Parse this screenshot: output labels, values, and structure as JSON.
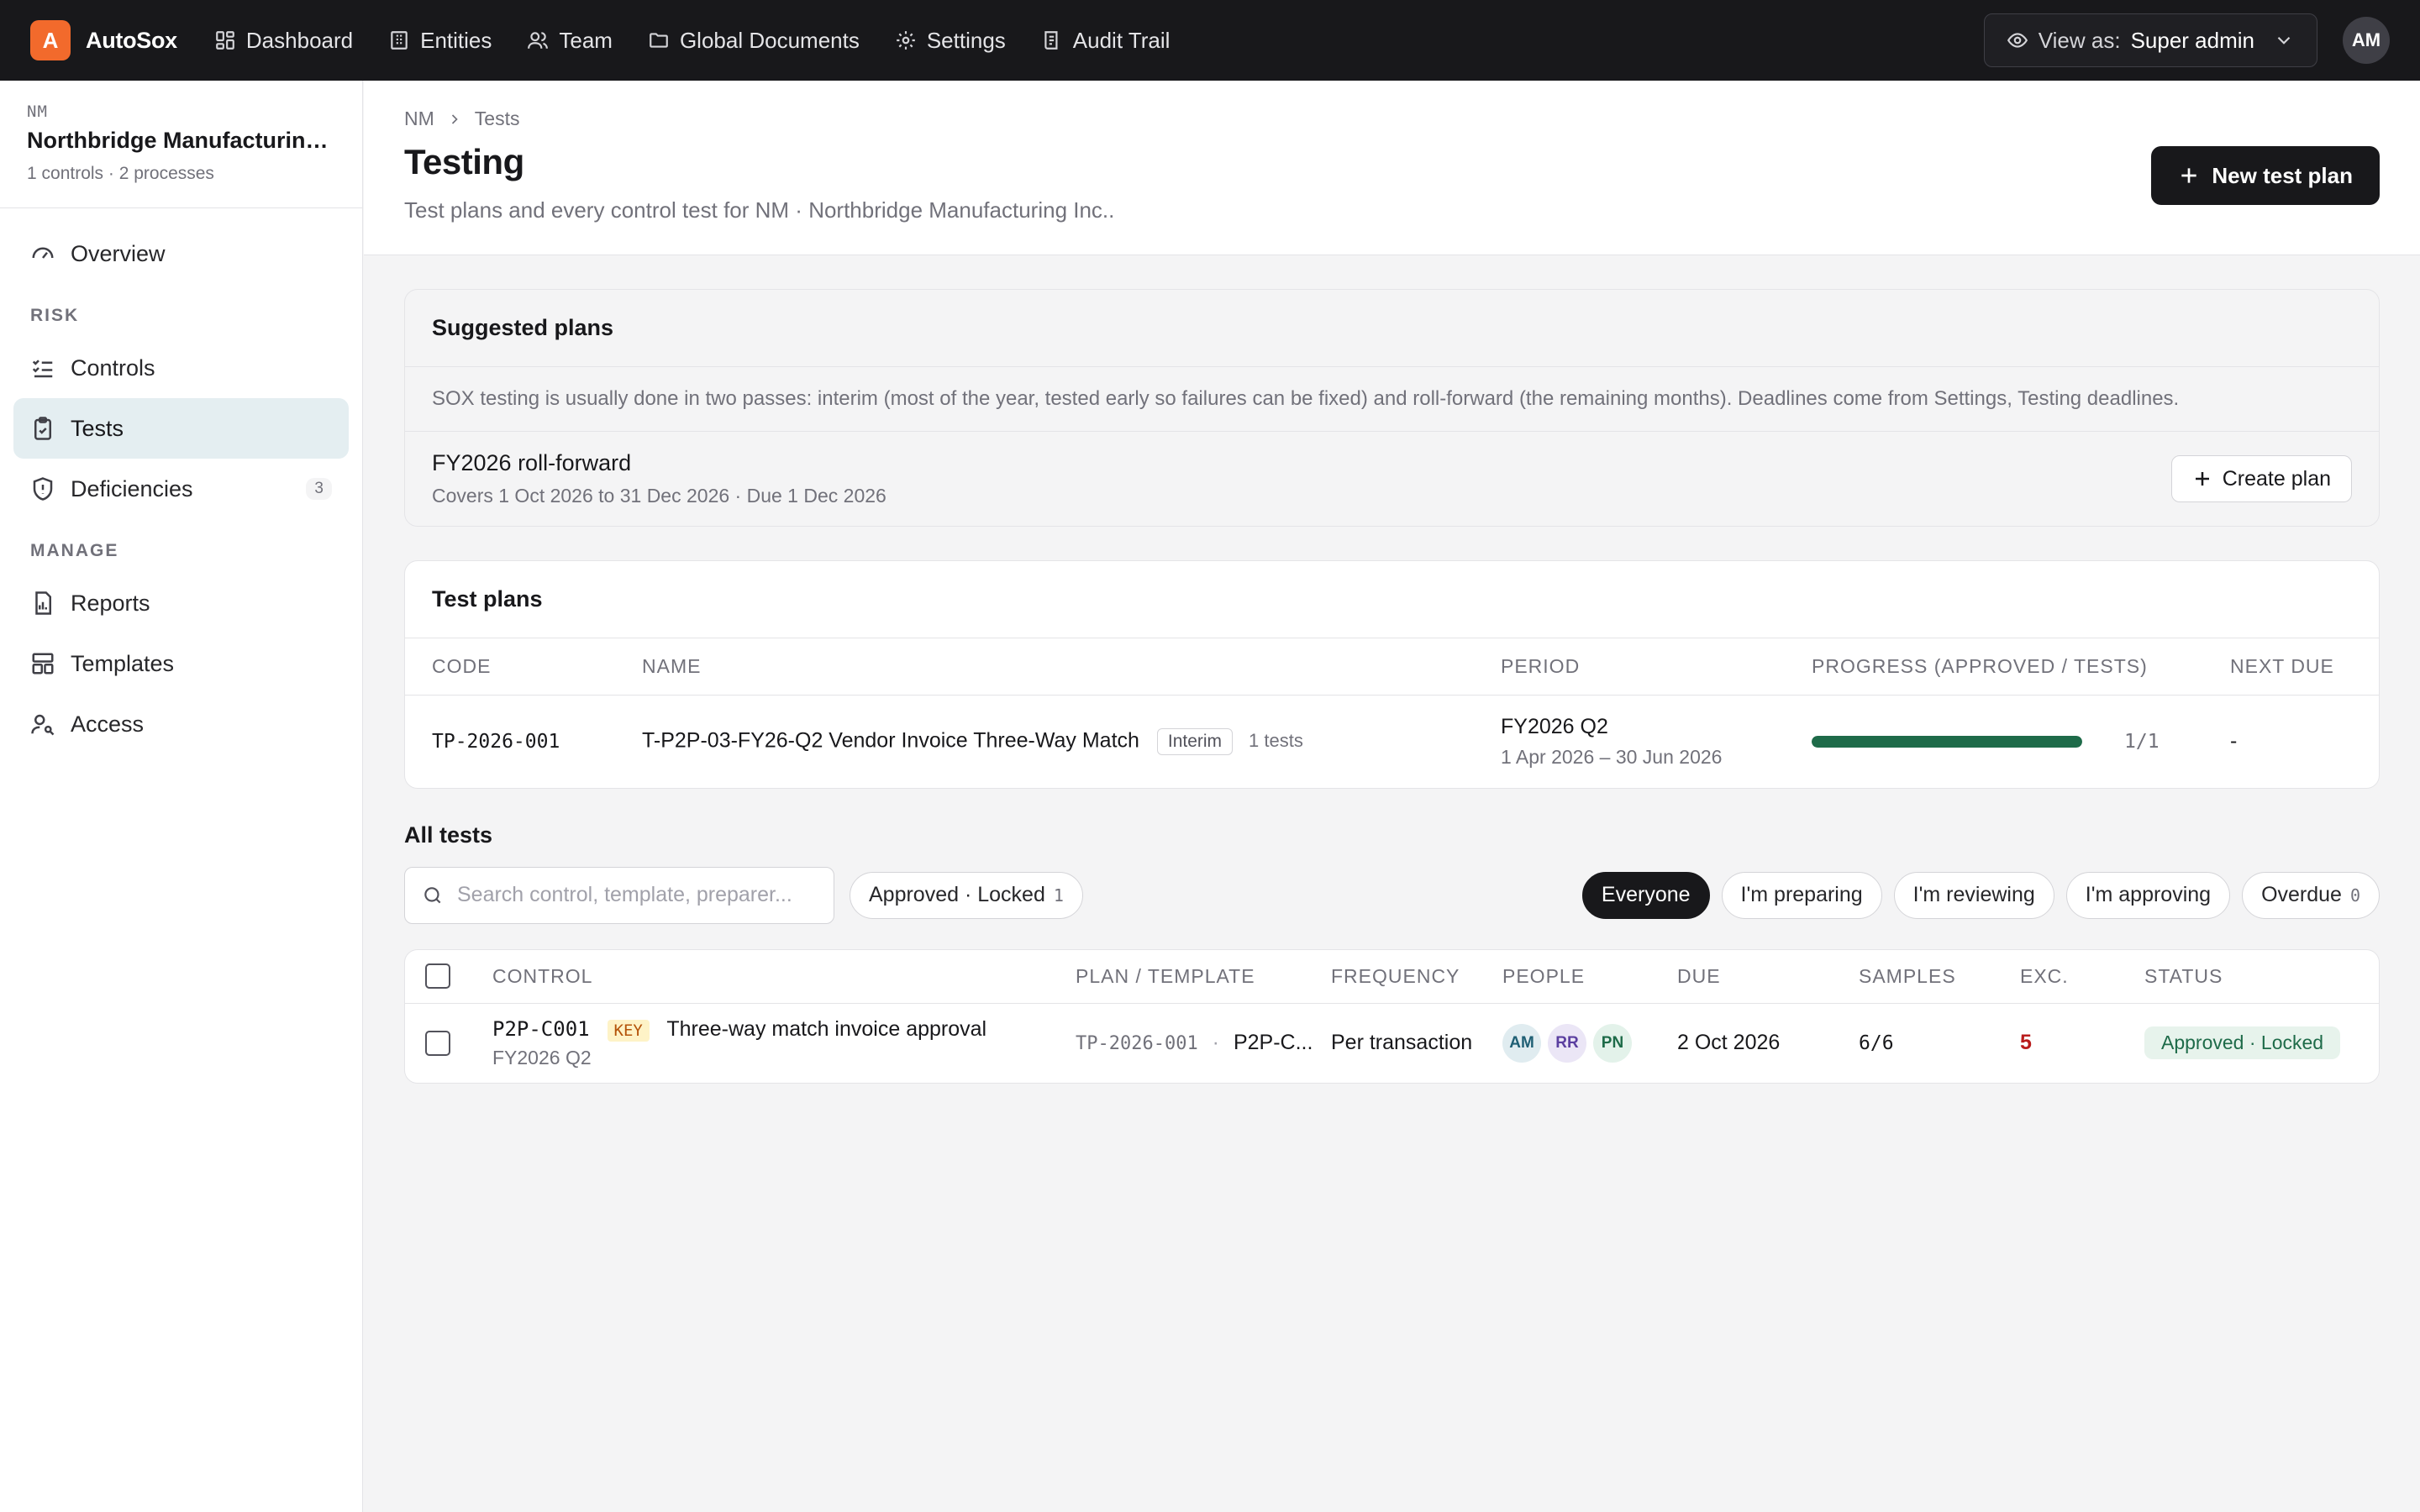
{
  "app": {
    "logo_letter": "A",
    "name": "AutoSox"
  },
  "topnav": [
    {
      "label": "Dashboard",
      "icon": "dashboard-icon"
    },
    {
      "label": "Entities",
      "icon": "building-icon"
    },
    {
      "label": "Team",
      "icon": "users-icon"
    },
    {
      "label": "Global Documents",
      "icon": "folder-icon"
    },
    {
      "label": "Settings",
      "icon": "gear-icon"
    },
    {
      "label": "Audit Trail",
      "icon": "audit-icon"
    }
  ],
  "viewas": {
    "prefix": "View as:",
    "role": "Super admin"
  },
  "user": {
    "initials": "AM"
  },
  "entity": {
    "code": "NM",
    "name": "Northbridge Manufacturing Inc.",
    "meta": "1 controls · 2 processes"
  },
  "sidebar": {
    "overview": "Overview",
    "risk_section": "RISK",
    "controls": "Controls",
    "tests": "Tests",
    "deficiencies": "Deficiencies",
    "deficiencies_count": "3",
    "manage_section": "MANAGE",
    "reports": "Reports",
    "templates": "Templates",
    "access": "Access"
  },
  "breadcrumb": {
    "root": "NM",
    "current": "Tests"
  },
  "page": {
    "title": "Testing",
    "subtitle": "Test plans and every control test for NM · Northbridge Manufacturing Inc..",
    "new_button": "New test plan"
  },
  "suggested": {
    "title": "Suggested plans",
    "note": "SOX testing is usually done in two passes: interim (most of the year, tested early so failures can be fixed) and roll-forward (the remaining months). Deadlines come from Settings, Testing deadlines.",
    "plan_name": "FY2026 roll-forward",
    "plan_meta": "Covers 1 Oct 2026 to 31 Dec 2026 · Due 1 Dec 2026",
    "create_button": "Create plan"
  },
  "test_plans": {
    "title": "Test plans",
    "headers": {
      "code": "CODE",
      "name": "NAME",
      "period": "PERIOD",
      "progress": "PROGRESS (APPROVED / TESTS)",
      "next_due": "NEXT DUE"
    },
    "rows": [
      {
        "code": "TP-2026-001",
        "name": "T-P2P-03-FY26-Q2 Vendor Invoice Three-Way Match",
        "tag": "Interim",
        "test_count": "1 tests",
        "period": "FY2026 Q2",
        "period_range": "1 Apr 2026 – 30 Jun 2026",
        "progress_fraction": 1.0,
        "progress_text": "1/1",
        "next_due": "-"
      }
    ]
  },
  "all_tests": {
    "title": "All tests",
    "search_placeholder": "Search control, template, preparer...",
    "filter_status": {
      "label": "Approved · Locked",
      "count": "1"
    },
    "scope_pills": [
      {
        "label": "Everyone",
        "active": true
      },
      {
        "label": "I'm preparing",
        "active": false
      },
      {
        "label": "I'm reviewing",
        "active": false
      },
      {
        "label": "I'm approving",
        "active": false
      }
    ],
    "overdue": {
      "label": "Overdue",
      "count": "0"
    },
    "headers": {
      "control": "CONTROL",
      "plan": "PLAN / TEMPLATE",
      "frequency": "FREQUENCY",
      "people": "PEOPLE",
      "due": "DUE",
      "samples": "SAMPLES",
      "exc": "EXC.",
      "status": "STATUS"
    },
    "rows": [
      {
        "control_code": "P2P-C001",
        "key": "KEY",
        "control_name": "Three-way match invoice approval",
        "period": "FY2026 Q2",
        "plan_code": "TP-2026-001",
        "separator": "·",
        "template": "P2P-C...",
        "frequency": "Per transaction",
        "people": [
          {
            "initials": "AM",
            "bg": "#e0ecf0",
            "fg": "#1f5f74"
          },
          {
            "initials": "RR",
            "bg": "#ebe6f6",
            "fg": "#5b3fa0"
          },
          {
            "initials": "PN",
            "bg": "#e3f2ea",
            "fg": "#1e6b49"
          }
        ],
        "due": "2 Oct 2026",
        "samples": "6/6",
        "exceptions": "5",
        "status": "Approved · Locked"
      }
    ]
  },
  "colors": {
    "brand": "#f26a2c",
    "topbar": "#18181b",
    "progress": "#1e6b49",
    "active_nav": "#e4eef1"
  }
}
